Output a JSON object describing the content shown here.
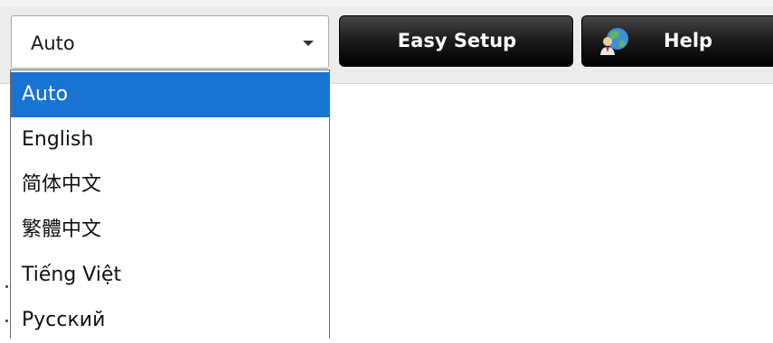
{
  "language_select": {
    "value": "Auto",
    "options": [
      "Auto",
      "English",
      "简体中文",
      "繁體中文",
      "Tiếng Việt",
      "Русский"
    ],
    "selected_index": 0,
    "caret_icon": "triangle-down"
  },
  "toolbar": {
    "easy_setup_label": "Easy Setup",
    "help_label": "Help",
    "help_icon": "globe-person-icon"
  },
  "colors": {
    "selected_option": "#1874d2",
    "button_dark": "#000000"
  }
}
